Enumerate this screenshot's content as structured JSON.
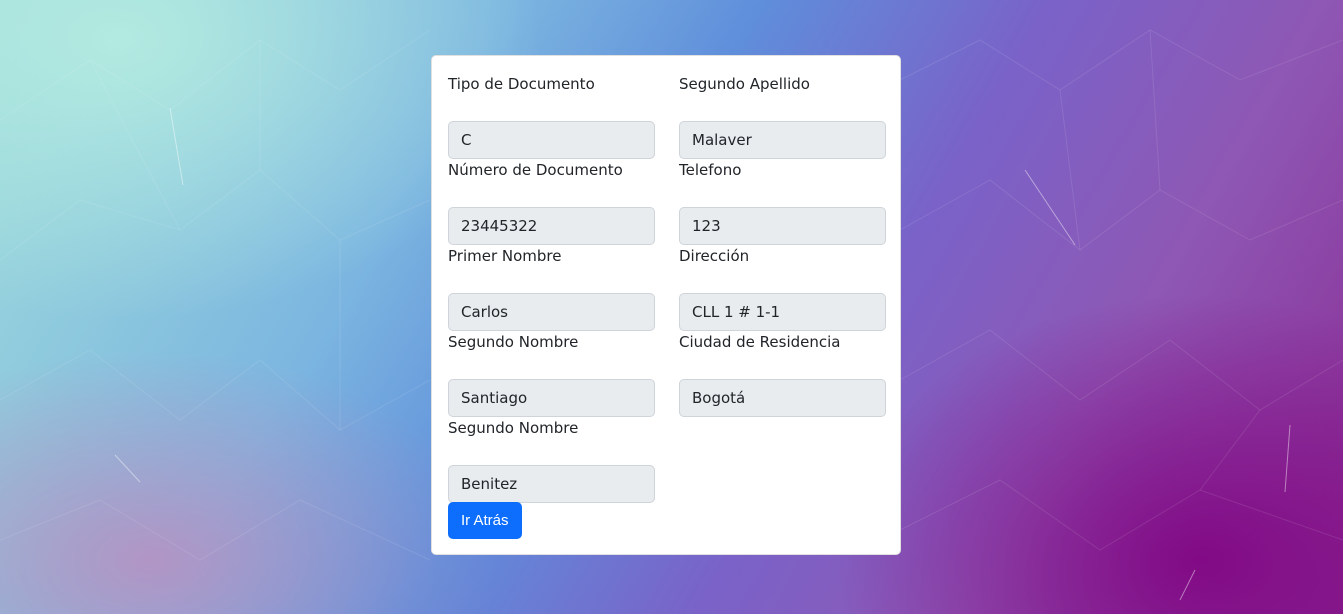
{
  "form": {
    "left_column": [
      {
        "label": "Tipo de Documento",
        "value": "C"
      },
      {
        "label": "Número de Documento",
        "value": "23445322"
      },
      {
        "label": "Primer Nombre",
        "value": "Carlos"
      },
      {
        "label": "Segundo Nombre",
        "value": "Santiago"
      },
      {
        "label": "Segundo Nombre",
        "value": "Benitez"
      }
    ],
    "right_column": [
      {
        "label": "Segundo Apellido",
        "value": "Malaver"
      },
      {
        "label": "Telefono",
        "value": "123"
      },
      {
        "label": "Dirección",
        "value": "CLL 1 # 1-1"
      },
      {
        "label": "Ciudad de Residencia",
        "value": "Bogotá"
      }
    ],
    "back_button_label": "Ir Atrás"
  },
  "colors": {
    "button": "#0d6efd",
    "input_background": "#e9ecef",
    "card_background": "#ffffff"
  }
}
